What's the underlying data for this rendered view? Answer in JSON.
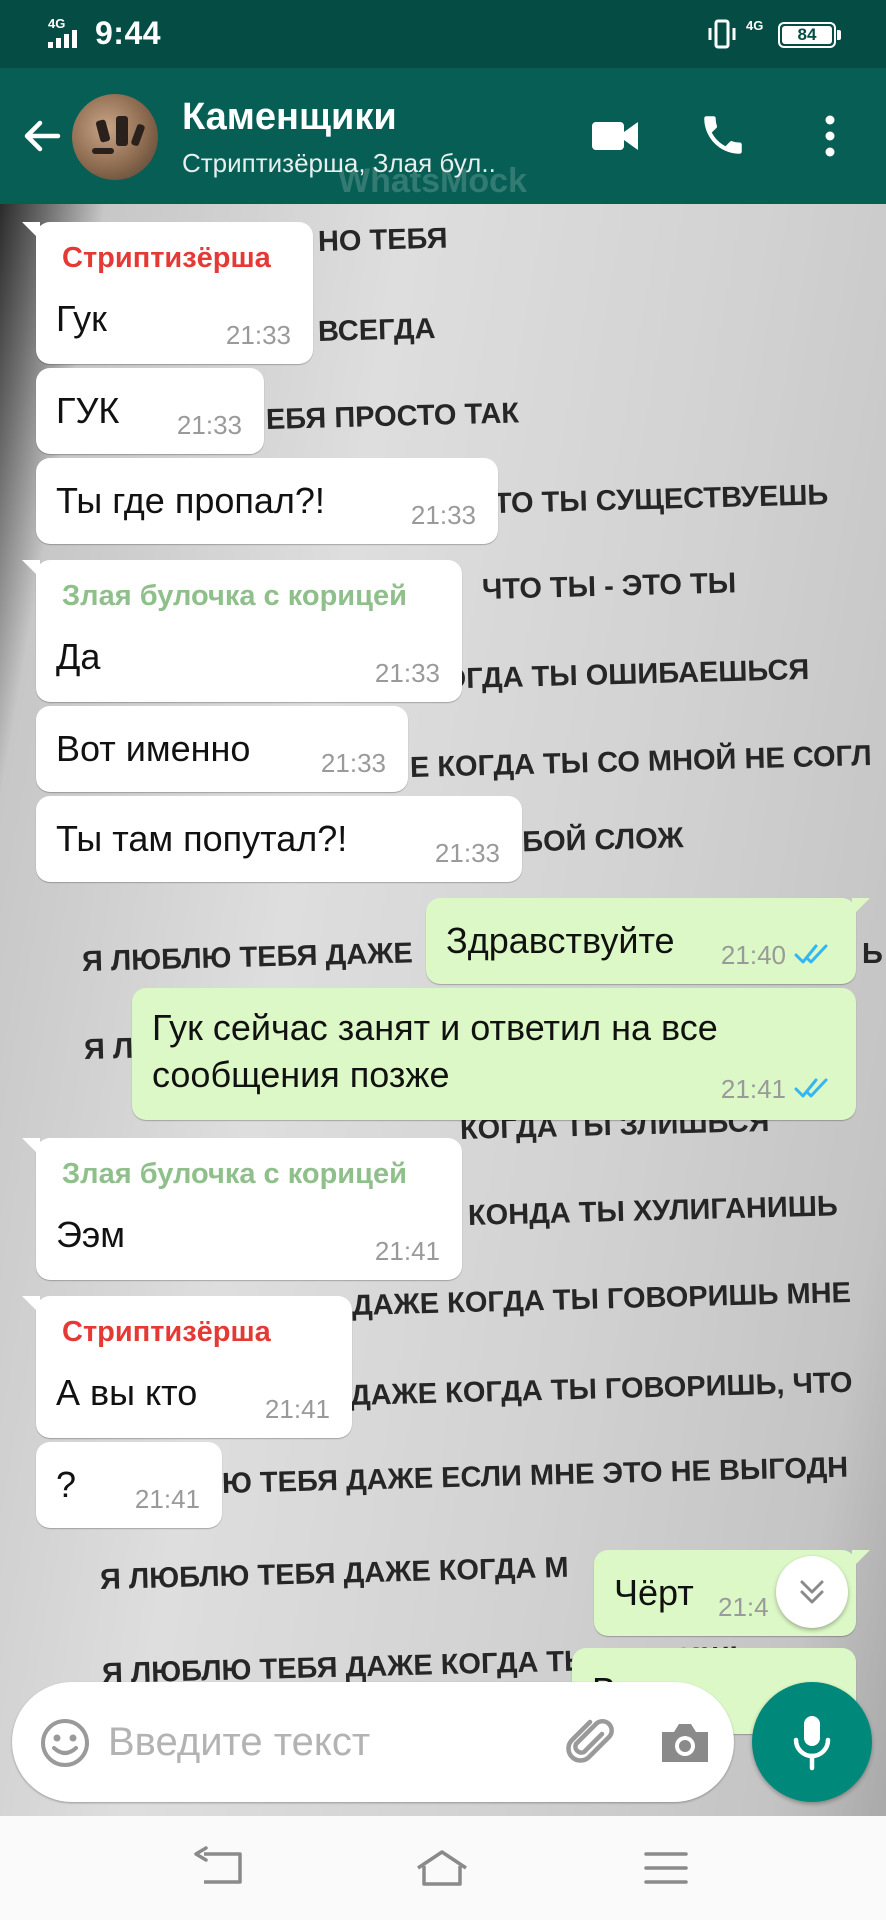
{
  "status_bar": {
    "network_left": "4G",
    "time": "9:44",
    "network_right": "4G",
    "battery": "84"
  },
  "header": {
    "title": "Каменщики",
    "subtitle": "Стриптизёрша, Злая бул..",
    "watermark": "WhatsMock"
  },
  "background_text": [
    "НО ТЕБЯ",
    "ВСЕГДА",
    "ЕБЯ ПРОСТО ТАК",
    "ТО ТЫ СУЩЕСТВУЕШЬ",
    "ЧТО ТЫ - ЭТО ТЫ",
    "КОГДА ТЫ ОШИБАЕШЬСЯ",
    "Е КОГДА ТЫ СО МНОЙ НЕ СОГЛ",
    "Я ЛЮБЛЮ ТЕБЯ Д        А МНЕ С ТОБОЙ СЛОЖ",
    "Я ЛЮБЛЮ ТЕБЯ ДАЖЕ",
    "Ь",
    "Я Л",
    "КОГДА ТЫ ЗЛИШЬСЯ",
    "КОНДА ТЫ ХУЛИГАНИШЬ",
    "ДАЖЕ КОГДА ТЫ ГОВОРИШЬ МНЕ",
    "ДАЖЕ КОГДА ТЫ ГОВОРИШЬ, ЧТО",
    "Ю ТЕБЯ ДАЖЕ ЕСЛИ МНЕ ЭТО НЕ ВЫГОДН",
    "Я ЛЮБЛЮ ТЕБЯ ДАЖЕ КОГДА М",
    "Я ЛЮБЛЮ ТЕБЯ ДАЖЕ КОГДА ТЫ УХОДИШЬ"
  ],
  "colors": {
    "header": "#075e54",
    "status_bar": "#054d44",
    "outgoing_bubble": "#dcf8c6",
    "sender_striptizersha": "#e53935",
    "sender_zlaya_bulochka": "#8fbf8a",
    "read_ticks": "#34b7f1",
    "mic_button": "#00897b"
  },
  "messages": [
    {
      "sender": "Стриптизёрша",
      "text": "Гук",
      "time": "21:33"
    },
    {
      "text": "ГУК",
      "time": "21:33"
    },
    {
      "text": "Ты где пропал?!",
      "time": "21:33"
    },
    {
      "sender": "Злая булочка с корицей",
      "text": "Да",
      "time": "21:33"
    },
    {
      "text": "Вот именно",
      "time": "21:33"
    },
    {
      "text": "Ты там попутал?!",
      "time": "21:33"
    },
    {
      "text": "Здравствуйте",
      "time": "21:40",
      "status": "read"
    },
    {
      "text": "Гук сейчас занят и ответил на все сообщения позже",
      "time": "21:41",
      "status": "read"
    },
    {
      "sender": "Злая булочка с корицей",
      "text": "Ээм",
      "time": "21:41"
    },
    {
      "sender": "Стриптизёрша",
      "text": "А вы кто",
      "time": "21:41"
    },
    {
      "text": "?",
      "time": "21:41"
    },
    {
      "text": "Чёрт",
      "time": "21:4"
    },
    {
      "text": "В"
    }
  ],
  "input": {
    "placeholder": "Введите текст"
  },
  "icons": {
    "back": "arrow-left-icon",
    "video": "video-camera-icon",
    "call": "phone-icon",
    "menu": "more-vertical-icon",
    "emoji": "emoji-icon",
    "attach": "paperclip-icon",
    "camera": "camera-icon",
    "mic": "microphone-icon",
    "scroll_down": "double-chevron-down-icon",
    "nav_back": "nav-back-icon",
    "nav_home": "nav-home-icon",
    "nav_recents": "nav-recents-icon"
  }
}
